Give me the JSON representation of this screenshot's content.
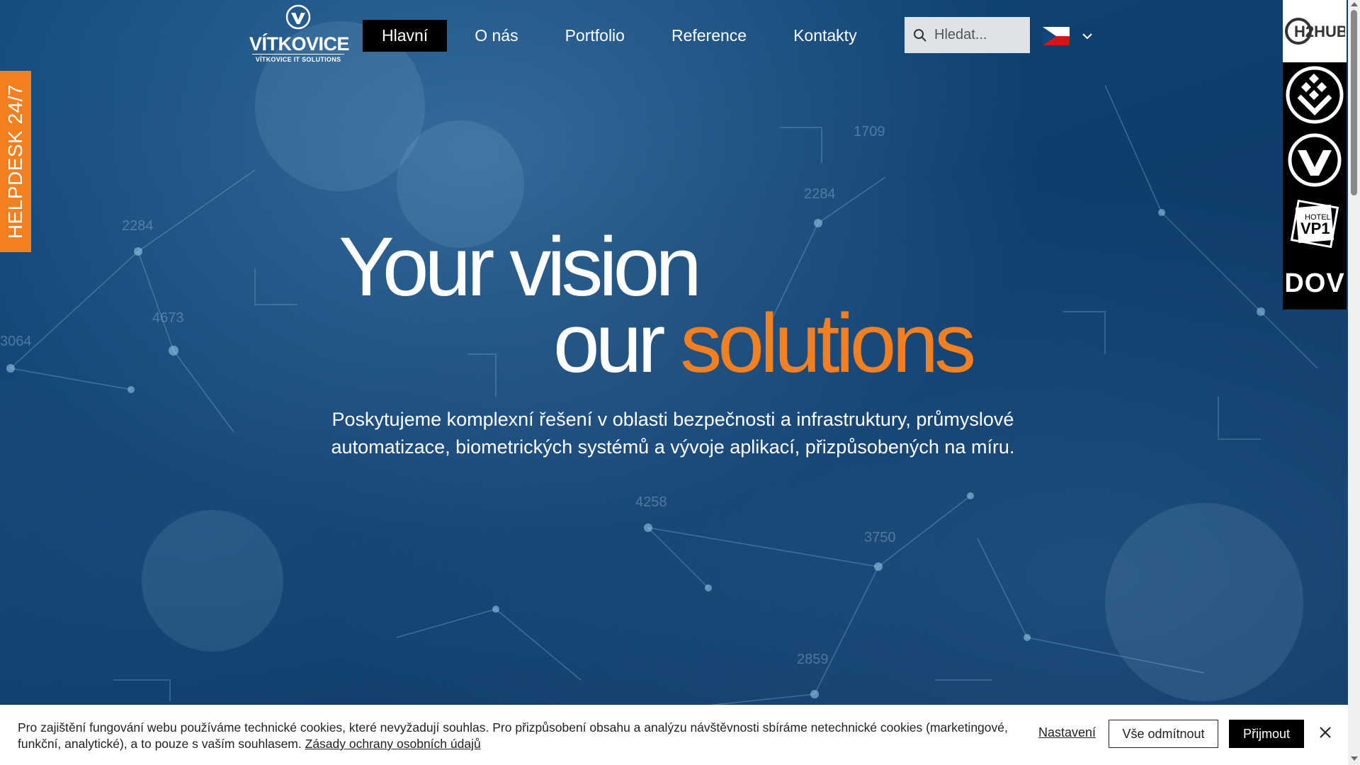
{
  "brand": {
    "name": "VÍTKOVICE",
    "subtitle": "VÍTKOVICE IT SOLUTIONS"
  },
  "nav": {
    "items": [
      {
        "label": "Hlavní",
        "active": true
      },
      {
        "label": "O nás",
        "active": false
      },
      {
        "label": "Portfolio",
        "active": false
      },
      {
        "label": "Reference",
        "active": false
      },
      {
        "label": "Kontakty",
        "active": false
      }
    ]
  },
  "search": {
    "placeholder": "Hledat..."
  },
  "language": {
    "current": "CZ",
    "icon": "czech-flag-icon"
  },
  "helpdesk": {
    "label": "HELPDESK 24/7"
  },
  "rail": {
    "h2hub": "H2HUB",
    "vp1_top": "HOTEL",
    "vp1": "VP1",
    "dov": "DOV"
  },
  "hero": {
    "line1": "Your vision",
    "line2_white": "our ",
    "line2_accent": "solutions",
    "subtitle": "Poskytujeme komplexní řešení v oblasti bezpečnosti a infrastruktury, průmyslové automatizace, biometrických systémů a vývoje aplikací, přizpůsobených na míru."
  },
  "cookie": {
    "text": "Pro zajištění fungování webu používáme technické cookies, které nevyžadují souhlas. Pro přizpůsobení obsahu a analýzu návštěvnosti sbíráme netechnické cookies (marketingové, funkční, analytické), a to pouze s vaším souhlasem. ",
    "link": "Zásady ochrany osobních údajů",
    "settings": "Nastavení",
    "reject": "Vše odmítnout",
    "accept": "Přijmout"
  },
  "background_numbers": [
    "2284",
    "2284",
    "4673",
    "3064",
    "1709",
    "4258",
    "3750",
    "2859"
  ],
  "colors": {
    "accent": "#f28021",
    "hero_bg": "#0f3b66",
    "nav_active": "#000000"
  }
}
